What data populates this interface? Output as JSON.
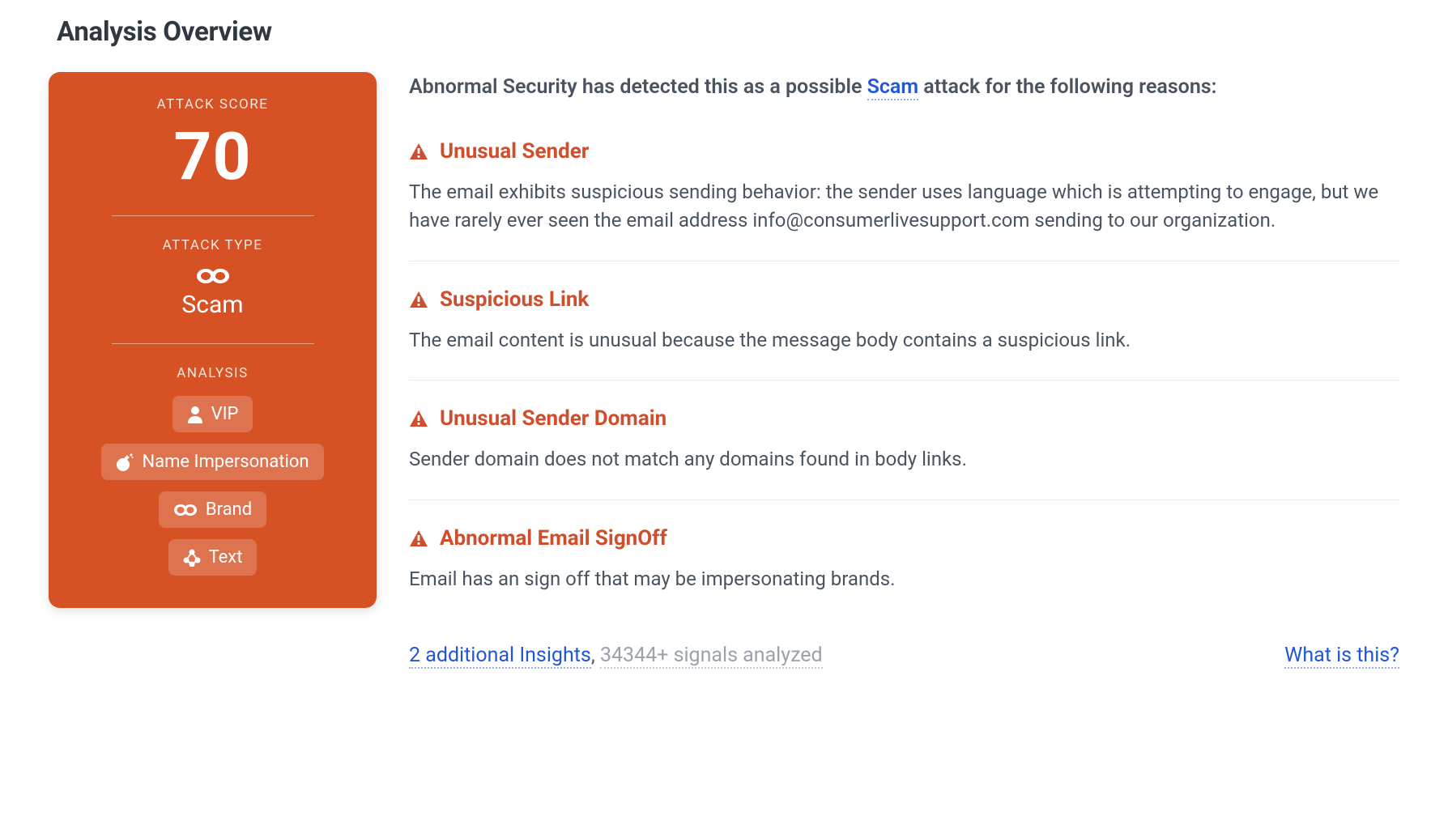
{
  "title": "Analysis Overview",
  "card": {
    "score_label": "ATTACK SCORE",
    "score_value": "70",
    "type_label": "ATTACK TYPE",
    "type_value": "Scam",
    "analysis_label": "ANALYSIS",
    "badges": [
      {
        "icon": "person",
        "label": "VIP"
      },
      {
        "icon": "bomb",
        "label": "Name Impersonation"
      },
      {
        "icon": "mask",
        "label": "Brand"
      },
      {
        "icon": "nodes",
        "label": "Text"
      }
    ]
  },
  "intro": {
    "prefix": "Abnormal Security has detected this as a possible ",
    "link_text": "Scam",
    "suffix": " attack for the following reasons:"
  },
  "insights": [
    {
      "title": "Unusual Sender",
      "desc": "The email exhibits suspicious sending behavior: the sender uses language which is attempting to engage, but we have rarely ever seen the email address info@consumerlivesupport.com sending to our organization."
    },
    {
      "title": "Suspicious Link",
      "desc": "The email content is unusual because the message body contains a suspicious link."
    },
    {
      "title": "Unusual Sender Domain",
      "desc": "Sender domain does not match any domains found in body links."
    },
    {
      "title": "Abnormal Email SignOff",
      "desc": "Email has an sign off that may be impersonating brands."
    }
  ],
  "footer": {
    "additional_link": "2 additional Insights",
    "signals_text": "34344+ signals analyzed",
    "what_is_this": "What is this?"
  },
  "colors": {
    "accent": "#d65224",
    "warn": "#cf4e2d",
    "link": "#2156d9"
  }
}
